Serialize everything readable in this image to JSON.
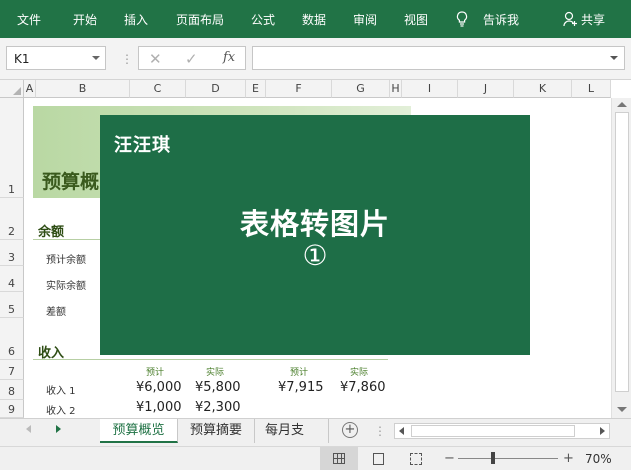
{
  "ribbon": {
    "tabs": [
      "文件",
      "开始",
      "插入",
      "页面布局",
      "公式",
      "数据",
      "审阅",
      "视图"
    ],
    "tell_me": "告诉我",
    "share": "共享"
  },
  "formula_bar": {
    "name_box": "K1",
    "fx_label": "fx",
    "formula": ""
  },
  "grid": {
    "columns": [
      "A",
      "B",
      "C",
      "D",
      "E",
      "F",
      "G",
      "H",
      "I",
      "J",
      "K",
      "L"
    ],
    "rows": [
      "1",
      "2",
      "3",
      "4",
      "5",
      "6",
      "7",
      "8",
      "9"
    ]
  },
  "sheet": {
    "title": "预算概",
    "sections": {
      "balance": "余额",
      "income": "收入"
    },
    "labels": {
      "expected_balance": "预计余额",
      "actual_balance": "实际余额",
      "difference": "差额",
      "income1": "收入 1",
      "income2": "收入 2"
    },
    "col_headers": {
      "expected": "预计",
      "actual": "实际",
      "expected2": "预计",
      "actual2": "实际"
    },
    "values": {
      "income1_expected": "¥6,000",
      "income1_actual": "¥5,800",
      "income2_expected": "¥1,000",
      "income2_actual": "¥2,300",
      "right_expected": "¥7,915",
      "right_actual": "¥7,860"
    }
  },
  "overlay": {
    "brand": "汪汪琪",
    "title": "表格转图片",
    "number": "①"
  },
  "sheet_tabs": [
    "预算概览",
    "预算摘要",
    "每月支"
  ],
  "status": {
    "zoom": "70%"
  },
  "colors": {
    "excel_green": "#217346",
    "overlay_green": "#1e6e47"
  }
}
